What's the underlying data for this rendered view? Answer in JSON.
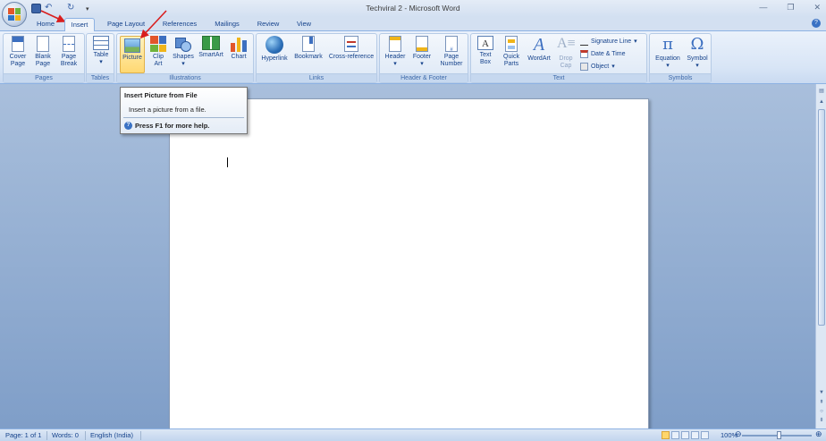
{
  "window": {
    "title": "Techviral 2 - Microsoft Word"
  },
  "tabs": [
    "Home",
    "Insert",
    "Page Layout",
    "References",
    "Mailings",
    "Review",
    "View"
  ],
  "active_tab": "Insert",
  "ribbon": {
    "pages": {
      "label": "Pages",
      "cover": "Cover\nPage",
      "blank": "Blank\nPage",
      "break": "Page\nBreak"
    },
    "tables": {
      "label": "Tables",
      "table": "Table"
    },
    "illustrations": {
      "label": "Illustrations",
      "picture": "Picture",
      "clipart": "Clip\nArt",
      "shapes": "Shapes",
      "smartart": "SmartArt",
      "chart": "Chart"
    },
    "links": {
      "label": "Links",
      "hyperlink": "Hyperlink",
      "bookmark": "Bookmark",
      "crossref": "Cross-reference"
    },
    "headerfooter": {
      "label": "Header & Footer",
      "header": "Header",
      "footer": "Footer",
      "pagenumber": "Page\nNumber"
    },
    "text": {
      "label": "Text",
      "textbox": "Text\nBox",
      "quickparts": "Quick\nParts",
      "wordart": "WordArt",
      "dropcap": "Drop\nCap",
      "signature": "Signature Line",
      "datetime": "Date & Time",
      "object": "Object"
    },
    "symbols": {
      "label": "Symbols",
      "equation": "Equation",
      "symbol": "Symbol"
    }
  },
  "tooltip": {
    "title": "Insert Picture from File",
    "body": "Insert a picture from a file.",
    "help": "Press F1 for more help."
  },
  "status": {
    "page": "Page: 1 of 1",
    "words": "Words: 0",
    "language": "English (India)",
    "zoom": "100%"
  },
  "colors": {
    "accent": "#15428b",
    "ribbon": "#dde8f6",
    "highlight": "#ffd872"
  }
}
